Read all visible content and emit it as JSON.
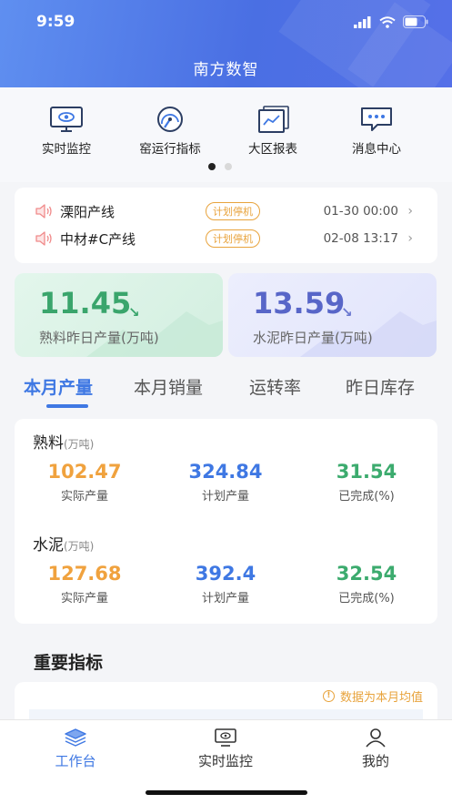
{
  "status_bar": {
    "time": "9:59"
  },
  "header": {
    "title": "南方数智"
  },
  "quick_menu": [
    {
      "label": "实时监控",
      "icon": "monitor-eye-icon"
    },
    {
      "label": "窑运行指标",
      "icon": "gauge-icon"
    },
    {
      "label": "大区报表",
      "icon": "report-chart-icon"
    },
    {
      "label": "消息中心",
      "icon": "message-icon"
    }
  ],
  "alerts": [
    {
      "line": "溧阳产线",
      "tag": "计划停机",
      "time": "01-30 00:00"
    },
    {
      "line": "中材#C产线",
      "tag": "计划停机",
      "time": "02-08 13:17"
    }
  ],
  "stats": [
    {
      "value": "11.45",
      "label": "熟料昨日产量(万吨)",
      "trend": "down"
    },
    {
      "value": "13.59",
      "label": "水泥昨日产量(万吨)",
      "trend": "down"
    }
  ],
  "tabs": [
    "本月产量",
    "本月销量",
    "运转率",
    "昨日库存"
  ],
  "active_tab": "本月产量",
  "production": [
    {
      "name": "熟料",
      "unit": "(万吨)",
      "metrics": [
        {
          "value": "102.47",
          "label": "实际产量"
        },
        {
          "value": "324.84",
          "label": "计划产量"
        },
        {
          "value": "31.54",
          "label": "已完成(%)"
        }
      ]
    },
    {
      "name": "水泥",
      "unit": "(万吨)",
      "metrics": [
        {
          "value": "127.68",
          "label": "实际产量"
        },
        {
          "value": "392.4",
          "label": "计划产量"
        },
        {
          "value": "32.54",
          "label": "已完成(%)"
        }
      ]
    }
  ],
  "indicators": {
    "title": "重要指标",
    "note": "数据为本月均值"
  },
  "tab_bar": [
    {
      "label": "工作台",
      "icon": "workbench-icon",
      "active": true
    },
    {
      "label": "实时监控",
      "icon": "monitor-icon",
      "active": false
    },
    {
      "label": "我的",
      "icon": "user-icon",
      "active": false
    }
  ],
  "colors": {
    "primary": "#3f78e3",
    "orange": "#f0a23e",
    "green": "#3cab6e",
    "tag": "#e8a33c"
  }
}
